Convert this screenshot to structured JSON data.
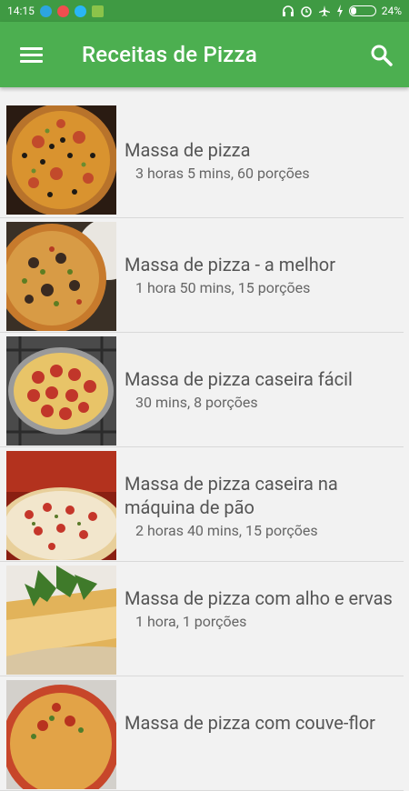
{
  "status": {
    "time": "14:15",
    "battery": "24%"
  },
  "toolbar": {
    "title": "Receitas de Pizza"
  },
  "recipes": [
    {
      "name": "Massa de pizza",
      "meta": "3 horas 5 mins, 60 porções"
    },
    {
      "name": "Massa de pizza - a melhor",
      "meta": "1 hora 50 mins, 15 porções"
    },
    {
      "name": "Massa de pizza caseira fácil",
      "meta": "30 mins, 8 porções"
    },
    {
      "name": "Massa de pizza caseira na máquina de pão",
      "meta": "2 horas 40 mins, 15 porções"
    },
    {
      "name": "Massa de pizza com alho e ervas",
      "meta": "1 hora, 1 porções"
    },
    {
      "name": "Massa de pizza com couve-flor",
      "meta": ""
    }
  ]
}
